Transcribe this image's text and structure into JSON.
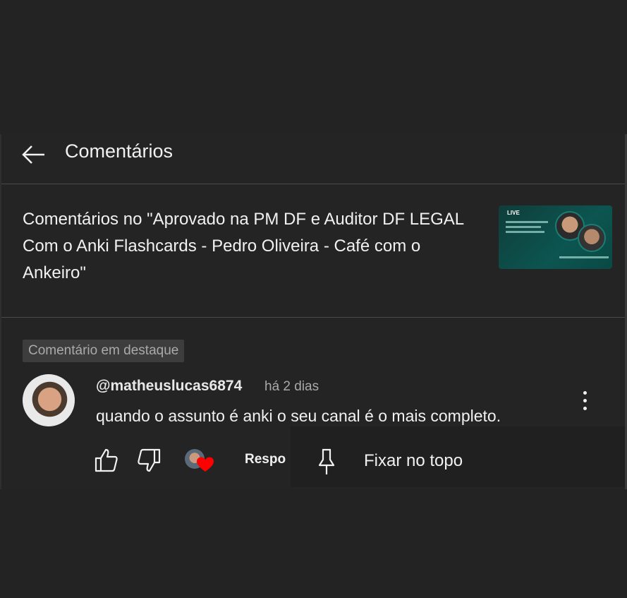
{
  "header": {
    "back_icon": "arrow-left-icon",
    "title": "Comentários"
  },
  "video": {
    "title": "Comentários no \"Aprovado na PM DF e Auditor DF LEGAL Com o Anki Flashcards - Pedro Oliveira - Café com o Ankeiro\"",
    "thumbnail": {
      "live_label": "LIVE"
    }
  },
  "comment": {
    "badge": "Comentário em destaque",
    "username": "@matheuslucas6874",
    "time": "há 2 dias",
    "text": "quando o assunto é anki o seu canal é o mais completo.",
    "more_icon": "more-vert-icon"
  },
  "actions": {
    "like_icon": "thumb-up-icon",
    "dislike_icon": "thumb-down-icon",
    "creator_heart_icon": "heart-icon",
    "reply_label": "Respo"
  },
  "menu": {
    "pin_icon": "pin-icon",
    "pin_label": "Fixar no topo"
  },
  "colors": {
    "background": "#232323",
    "text": "#f1f1f1",
    "muted": "#aaaaaa",
    "heart": "#ff0000",
    "badge_bg": "#3d3d3d"
  }
}
